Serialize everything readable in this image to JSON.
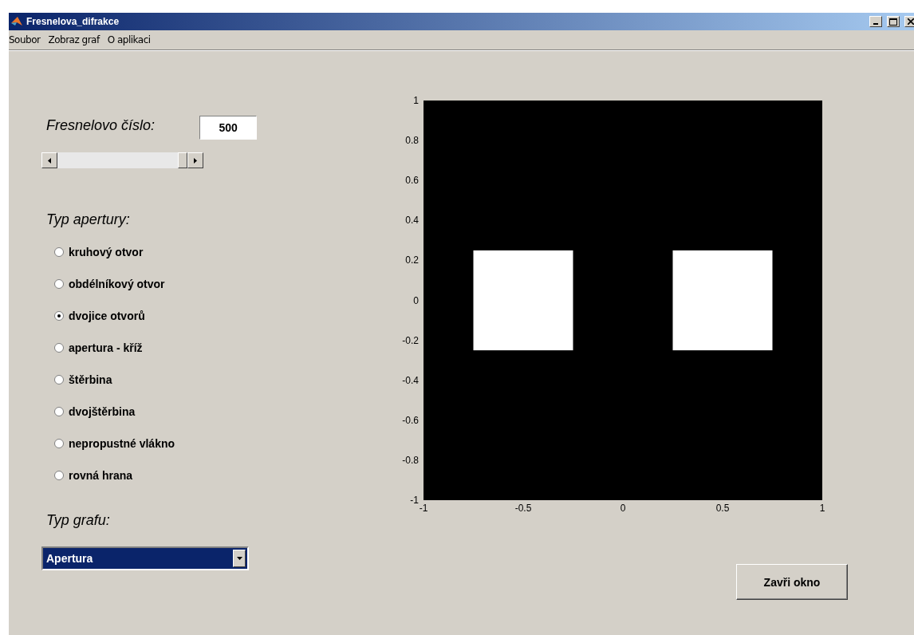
{
  "window": {
    "title": "Fresnelova_difrakce"
  },
  "menu": [
    {
      "label": "Soubor"
    },
    {
      "label": "Zobraz graf"
    },
    {
      "label": "O aplikaci"
    }
  ],
  "fresnel": {
    "label": "Fresnelovo číslo:",
    "value": "500",
    "level": 1
  },
  "aperture": {
    "label": "Typ apertury:",
    "options": [
      {
        "label": "kruhový otvor",
        "selected": false
      },
      {
        "label": "obdélníkový otvor",
        "selected": false
      },
      {
        "label": "dvojice otvorů",
        "selected": true
      },
      {
        "label": "apertura - kříž",
        "selected": false
      },
      {
        "label": "štěrbina",
        "selected": false
      },
      {
        "label": "dvojštěrbina",
        "selected": false
      },
      {
        "label": "nepropustné vlákno",
        "selected": false
      },
      {
        "label": "rovná hrana",
        "selected": false
      }
    ]
  },
  "graph_type": {
    "label": "Typ grafu:",
    "value": "Apertura"
  },
  "plot": {
    "xticks": [
      "-1",
      "-0.5",
      "0",
      "0.5",
      "1"
    ],
    "yticks": [
      "1",
      "0.8",
      "0.6",
      "0.4",
      "0.2",
      "0",
      "-0.2",
      "-0.4",
      "-0.6",
      "-0.8",
      "-1"
    ]
  },
  "close_button": "Zavři okno"
}
